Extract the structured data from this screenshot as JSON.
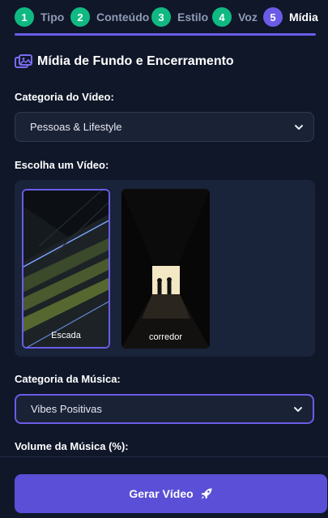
{
  "steps": [
    {
      "num": "1",
      "label": "Tipo"
    },
    {
      "num": "2",
      "label": "Conteúdo"
    },
    {
      "num": "3",
      "label": "Estilo"
    },
    {
      "num": "4",
      "label": "Voz"
    },
    {
      "num": "5",
      "label": "Mídia"
    }
  ],
  "active_step": "5",
  "section": {
    "title": "Mídia de Fundo e Encerramento",
    "icon": "media-images-icon"
  },
  "video_category": {
    "label": "Categoria do Vídeo:",
    "value": "Pessoas & Lifestyle"
  },
  "video_choice": {
    "label": "Escolha um Vídeo:",
    "videos": [
      {
        "caption": "Escada",
        "selected": true,
        "thumbnail": "escalator-scene"
      },
      {
        "caption": "corredor",
        "selected": false,
        "thumbnail": "tunnel-silhouettes-scene"
      }
    ]
  },
  "music_category": {
    "label": "Categoria da Música:",
    "value": "Vibes Positivas"
  },
  "music_volume": {
    "label": "Volume da Música (%):"
  },
  "cta": {
    "label": "Gerar Vídeo",
    "icon": "rocket-icon"
  },
  "colors": {
    "background": "#0f1729",
    "accent": "#6b5ce7",
    "step_done": "#10b981",
    "cta": "#5a4fd6"
  }
}
